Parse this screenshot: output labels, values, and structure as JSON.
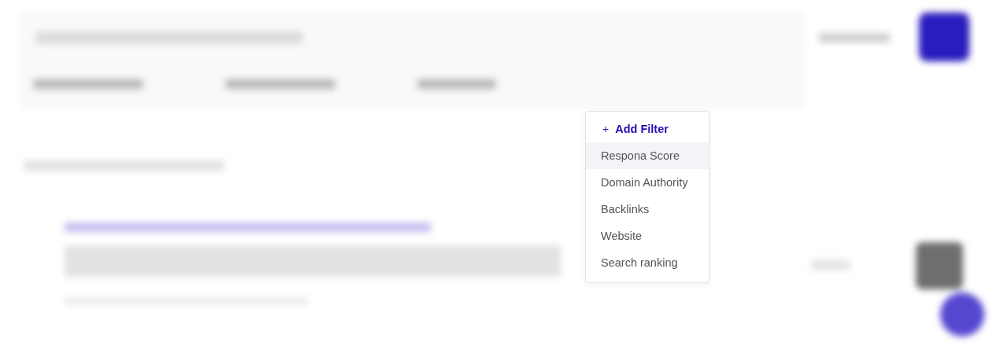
{
  "filter_menu": {
    "add_filter": {
      "icon": "+",
      "label": "Add Filter"
    },
    "items": [
      {
        "label": "Respona Score",
        "highlighted": true
      },
      {
        "label": "Domain Authority",
        "highlighted": false
      },
      {
        "label": "Backlinks",
        "highlighted": false
      },
      {
        "label": "Website",
        "highlighted": false
      },
      {
        "label": "Search ranking",
        "highlighted": false
      }
    ]
  }
}
